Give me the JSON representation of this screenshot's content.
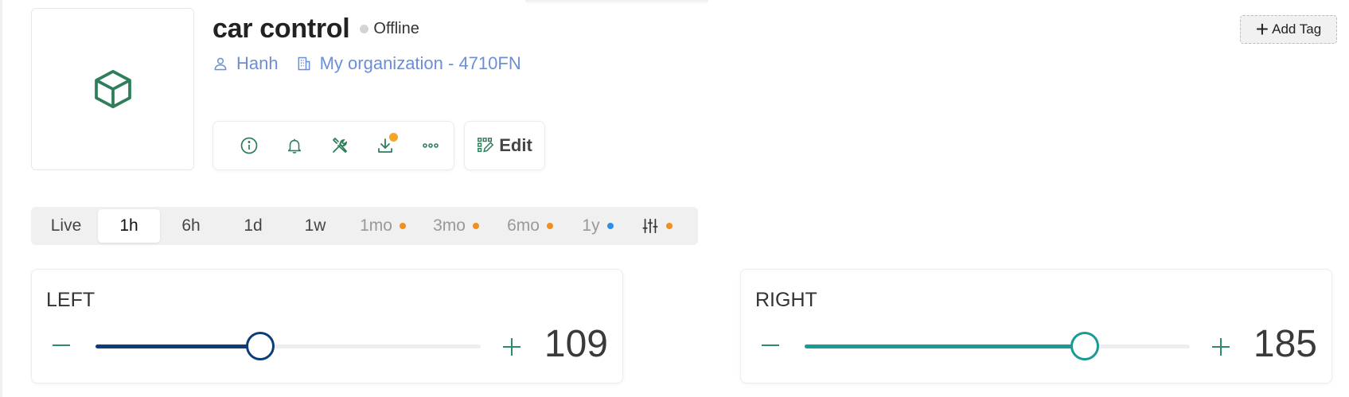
{
  "device": {
    "title": "car control",
    "status": "Offline",
    "owner": "Hanh",
    "organization": "My organization - 4710FN",
    "icon": "cube-icon"
  },
  "add_tag_label": "Add Tag",
  "actions": [
    {
      "name": "info-icon"
    },
    {
      "name": "bell-icon"
    },
    {
      "name": "tools-icon"
    },
    {
      "name": "download-icon",
      "badge": true
    },
    {
      "name": "more-icon"
    }
  ],
  "edit_label": "Edit",
  "time_ranges": [
    {
      "label": "Live",
      "state": "normal"
    },
    {
      "label": "1h",
      "state": "active"
    },
    {
      "label": "6h",
      "state": "normal"
    },
    {
      "label": "1d",
      "state": "normal"
    },
    {
      "label": "1w",
      "state": "normal"
    },
    {
      "label": "1mo",
      "state": "disabled",
      "dot": "#f0901e"
    },
    {
      "label": "3mo",
      "state": "disabled",
      "dot": "#f0901e"
    },
    {
      "label": "6mo",
      "state": "disabled",
      "dot": "#f0901e"
    },
    {
      "label": "1y",
      "state": "disabled",
      "dot": "#2f8ee6"
    },
    {
      "label": "",
      "state": "normal",
      "icon": "sliders-icon",
      "dot": "#f0901e"
    }
  ],
  "sliders": [
    {
      "name": "left",
      "label": "LEFT",
      "value": "109",
      "fraction": 0.427,
      "color": "#0b3d7a"
    },
    {
      "name": "right",
      "label": "RIGHT",
      "value": "185",
      "fraction": 0.728,
      "color": "#169c94"
    }
  ],
  "colors": {
    "accent_green": "#2e7d5b",
    "link_blue": "#6b8ed6",
    "badge_orange": "#f5a623"
  }
}
